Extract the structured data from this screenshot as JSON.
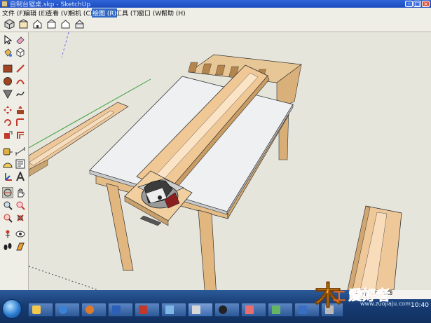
{
  "window": {
    "title": "自制台锯桌.skp - SketchUp",
    "minimize_glyph": "–",
    "maximize_glyph": "□",
    "close_glyph": "×"
  },
  "menu": {
    "items": [
      {
        "label": "文件 (F)"
      },
      {
        "label": "编辑 (E)"
      },
      {
        "label": "查看 (V)"
      },
      {
        "label": "相机 (C)"
      },
      {
        "label": "绘图 (R)"
      },
      {
        "label": "工具 (T)"
      },
      {
        "label": "窗口 (W)"
      },
      {
        "label": "帮助 (H)"
      }
    ]
  },
  "toolbar": {
    "icons": [
      "iso-view-icon",
      "top-view-icon",
      "front-view-icon",
      "right-view-icon",
      "back-view-icon",
      "left-view-icon"
    ]
  },
  "left_toolbar": {
    "icons": [
      "select-icon",
      "eraser-icon",
      "paint-bucket-icon",
      "component-icon",
      "rectangle-icon",
      "line-icon",
      "circle-icon",
      "arc-icon",
      "polygon-icon",
      "freehand-icon",
      "move-icon",
      "push-pull-icon",
      "rotate-icon",
      "follow-me-icon",
      "scale-icon",
      "offset-icon",
      "tape-measure-icon",
      "dimension-icon",
      "protractor-icon",
      "text-icon",
      "axes-icon",
      "3d-text-icon",
      "orbit-icon",
      "pan-icon",
      "zoom-icon",
      "zoom-window-icon",
      "zoom-extents-icon",
      "previous-view-icon",
      "position-camera-icon",
      "look-around-icon",
      "walk-icon",
      "section-plane-icon"
    ]
  },
  "taskbar": {
    "buttons": [
      "folder",
      "ie",
      "media",
      "word",
      "sketchup",
      "sketchup-2",
      "browser",
      "qq",
      "paint",
      "photo",
      "app-11",
      "app-12"
    ],
    "ime_glyphs": [
      "S",
      "中",
      "♪",
      "⌨"
    ],
    "clock": "10:40"
  },
  "watermark": {
    "brand": "木工爱好者",
    "url": "www.zuojiaju.com"
  },
  "colors": {
    "titlebar": "#1f52c8",
    "wood": "#e3c18f",
    "tabletop": "#eef0f1",
    "fence": "#f0c896",
    "taskbar": "#1f4a86"
  }
}
